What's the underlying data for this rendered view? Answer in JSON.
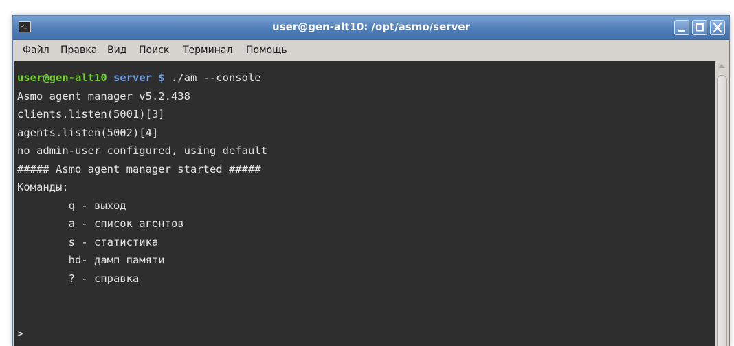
{
  "window": {
    "title": "user@gen-alt10: /opt/asmo/server",
    "icon": "terminal-icon",
    "controls": [
      "minimize-icon",
      "maximize-icon",
      "close-icon"
    ]
  },
  "menu": {
    "file": "Файл",
    "edit": "Правка",
    "view": "Вид",
    "search": "Поиск",
    "terminal": "Терминал",
    "help": "Помощь"
  },
  "terminal": {
    "prompt_user": "user@gen-alt10",
    "prompt_dir": " server $",
    "command": " ./am --console",
    "lines": [
      "Asmo agent manager v5.2.438",
      "clients.listen(5001)[3]",
      "agents.listen(5002)[4]",
      "no admin-user configured, using default",
      "##### Asmo agent manager started #####",
      "Команды:",
      "        q - выход",
      "        a - список агентов",
      "        s - статистика",
      "        hd- дамп памяти",
      "        ? - справка"
    ],
    "input_prompt": ">"
  },
  "colors": {
    "terminal_bg": "#2e2e2e",
    "terminal_fg": "#e3e3e3",
    "prompt_user": "#6fd12a",
    "prompt_dir": "#6f9ee6",
    "titlebar": "#4f7db8"
  }
}
